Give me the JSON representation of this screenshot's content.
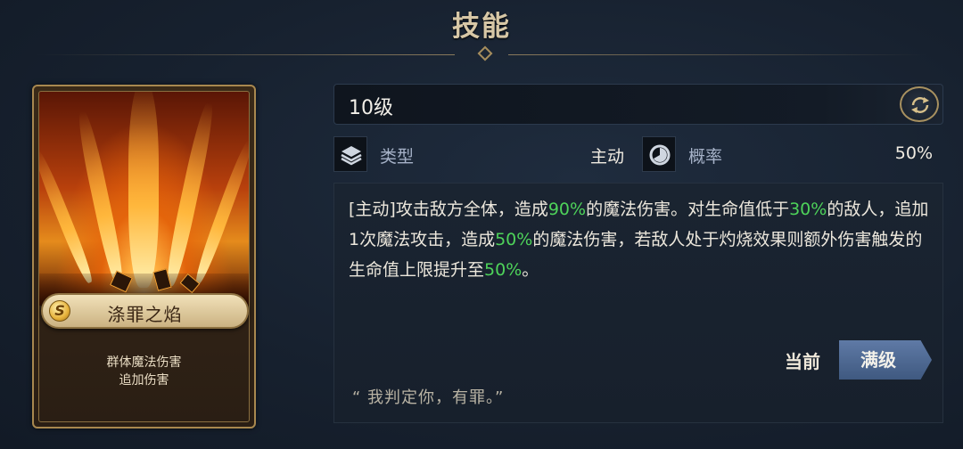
{
  "header": {
    "title": "技能"
  },
  "card": {
    "rank_badge": "S",
    "skill_name": "涤罪之焰",
    "tags": [
      "群体魔法伤害",
      "追加伤害"
    ]
  },
  "level": {
    "text": "10级"
  },
  "stats": {
    "type": {
      "label": "类型",
      "value": "主动",
      "icon": "layers-icon"
    },
    "chance": {
      "label": "概率",
      "value": "50%",
      "icon": "pie-chart-icon"
    }
  },
  "description": {
    "segments": [
      {
        "text": "[主动]攻击敌方全体，造成",
        "highlight": false
      },
      {
        "text": "90%",
        "highlight": true
      },
      {
        "text": "的魔法伤害。对生命值低于",
        "highlight": false
      },
      {
        "text": "30%",
        "highlight": true
      },
      {
        "text": "的敌人，追加1次魔法攻击，造成",
        "highlight": false
      },
      {
        "text": "50%",
        "highlight": true
      },
      {
        "text": "的魔法伤害，若敌人处于灼烧效果则额外伤害触发的生命值上限提升至",
        "highlight": false
      },
      {
        "text": "50%",
        "highlight": true
      },
      {
        "text": "。",
        "highlight": false
      }
    ],
    "highlight_color": "#4ed35a"
  },
  "level_toggle": {
    "current_label": "当前",
    "max_label": "满级",
    "selected": "满级"
  },
  "quote": "“ 我判定你，有罪。”"
}
